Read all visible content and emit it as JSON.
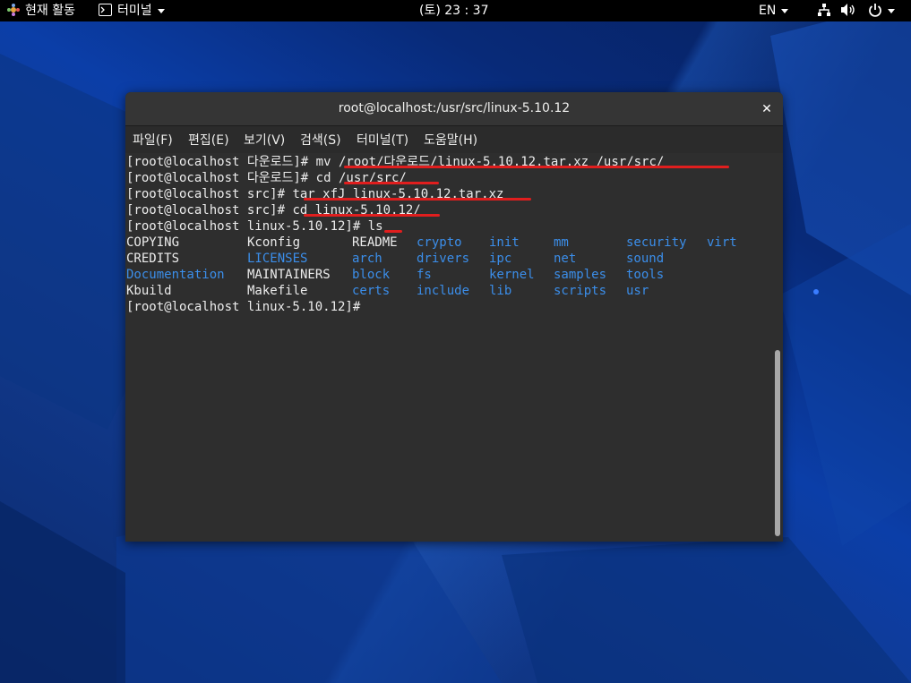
{
  "topbar": {
    "activities_label": "현재 활동",
    "app_menu_label": "터미널",
    "clock": "(토) 23 : 37",
    "input_method": "EN"
  },
  "window": {
    "title": "root@localhost:/usr/src/linux-5.10.12",
    "close_glyph": "✕"
  },
  "menu": [
    "파일(F)",
    "편집(E)",
    "보기(V)",
    "검색(S)",
    "터미널(T)",
    "도움말(H)"
  ],
  "terminal": {
    "lines": [
      {
        "prompt": "[root@localhost 다운로드]# ",
        "command": "mv /root/다운로드/linux-5.10.12.tar.xz /usr/src/"
      },
      {
        "prompt": "[root@localhost 다운로드]# ",
        "command": "cd /usr/src/"
      },
      {
        "prompt": "[root@localhost src]# ",
        "command": "tar xfJ linux-5.10.12.tar.xz"
      },
      {
        "prompt": "[root@localhost src]# ",
        "command": "cd linux-5.10.12/"
      },
      {
        "prompt": "[root@localhost linux-5.10.12]# ",
        "command": "ls"
      }
    ],
    "ls_rows": [
      [
        "COPYING",
        "Kconfig",
        "README",
        "crypto",
        "init",
        "mm",
        "security",
        "virt"
      ],
      [
        "CREDITS",
        "LICENSES",
        "arch",
        "drivers",
        "ipc",
        "net",
        "sound",
        ""
      ],
      [
        "Documentation",
        "MAINTAINERS",
        "block",
        "fs",
        "kernel",
        "samples",
        "tools",
        ""
      ],
      [
        "Kbuild",
        "Makefile",
        "certs",
        "include",
        "lib",
        "scripts",
        "usr",
        ""
      ]
    ],
    "ls_dir_flags": [
      [
        false,
        false,
        false,
        true,
        true,
        true,
        true,
        true
      ],
      [
        false,
        true,
        true,
        true,
        true,
        true,
        true,
        false
      ],
      [
        true,
        false,
        true,
        true,
        true,
        true,
        true,
        false
      ],
      [
        false,
        false,
        true,
        true,
        true,
        true,
        true,
        false
      ]
    ],
    "final_prompt": "[root@localhost linux-5.10.12]# ",
    "dir_color": "#3b8eea",
    "highlight_color": "#e01e1e"
  }
}
